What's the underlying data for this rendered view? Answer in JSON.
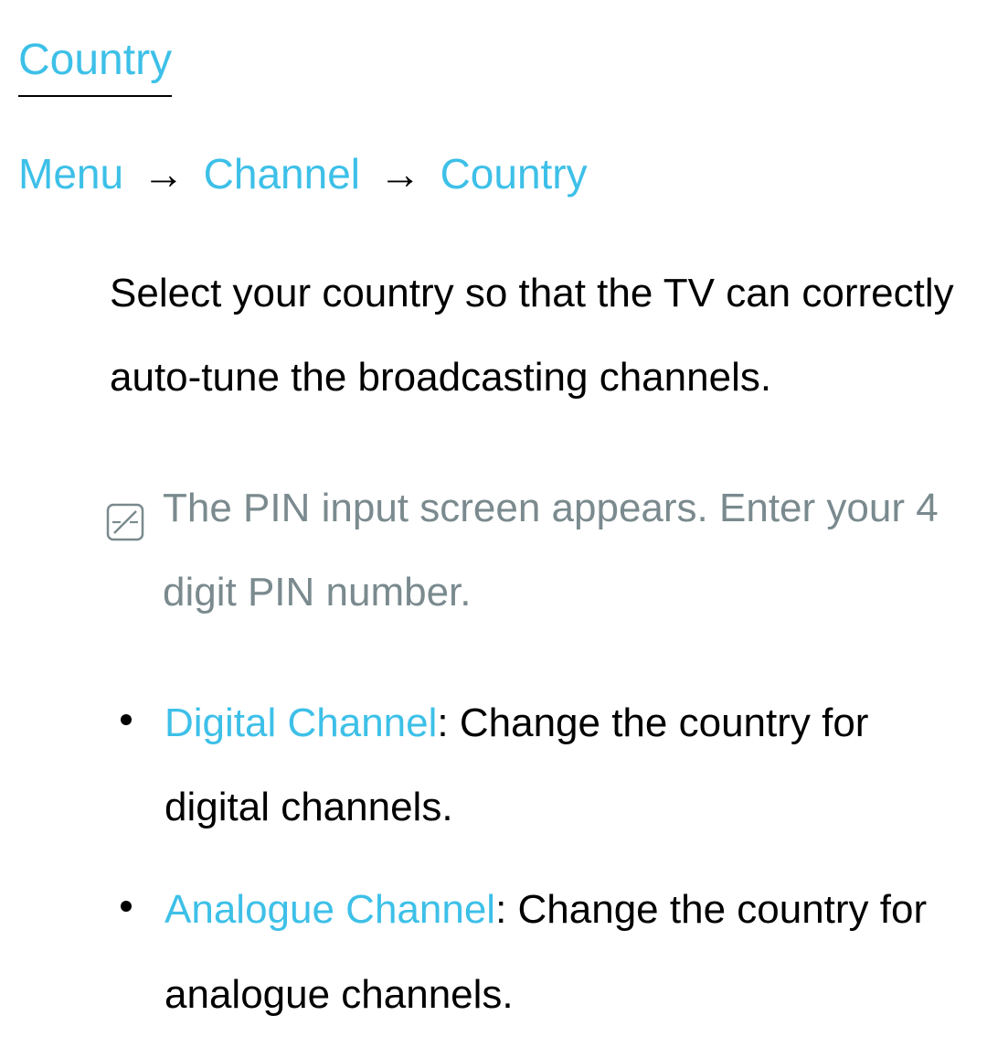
{
  "title": "Country",
  "breadcrumb": {
    "item1": "Menu",
    "item2": "Channel",
    "item3": "Country"
  },
  "intro": "Select your country so that the TV can correctly auto-tune the broadcasting channels.",
  "note": "The PIN input screen appears. Enter your 4 digit PIN number.",
  "items": [
    {
      "label": "Digital Channel",
      "desc": ": Change the country for digital channels."
    },
    {
      "label": "Analogue Channel",
      "desc": ": Change the country for analogue channels."
    }
  ]
}
